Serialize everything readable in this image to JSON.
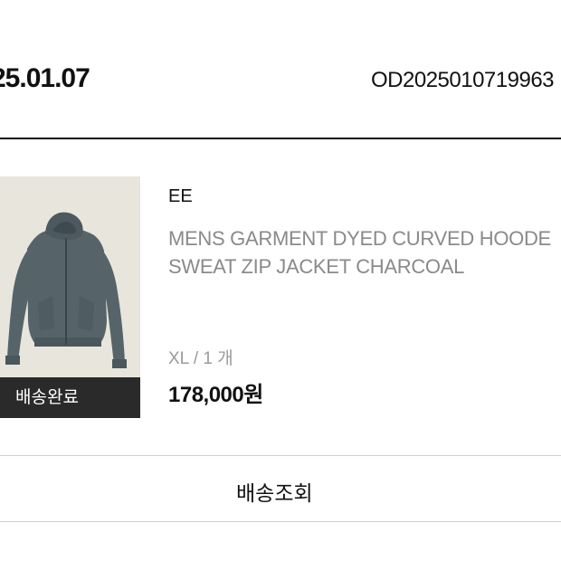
{
  "order": {
    "date": "25.01.07",
    "number": "OD2025010719963"
  },
  "product": {
    "thumbnail_icon": "hoodie-image",
    "status": "배송완료",
    "brand": "EE",
    "name_line1": "MENS GARMENT DYED CURVED HOODE",
    "name_line2": "SWEAT ZIP JACKET CHARCOAL",
    "option": "XL / 1 개",
    "price": "178,000원"
  },
  "actions": {
    "track_label": "배송조회"
  },
  "colors": {
    "accent": "#111111",
    "muted_text": "#8a8a8a",
    "status_bg": "#2a2a2a",
    "thumb_bg": "#e8e5dc",
    "garment": "#56646a"
  }
}
